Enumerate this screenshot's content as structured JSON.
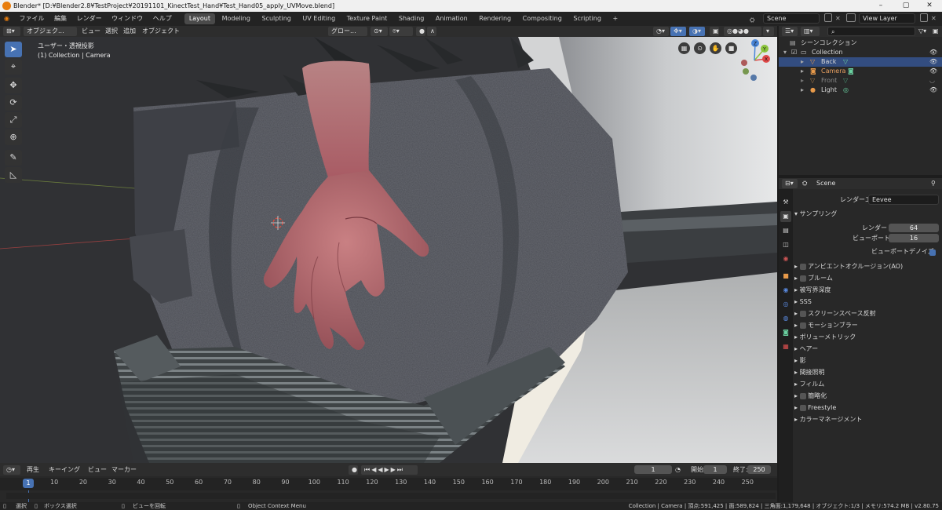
{
  "title_bar": {
    "title": "Blender* [D:¥Blender2.8¥TestProject¥20191101_KinectTest_Hand¥Test_Hand05_apply_UVMove.blend]",
    "minimize": "–",
    "maximize": "▢",
    "close": "✕"
  },
  "menu": [
    "ファイル",
    "編集",
    "レンダー",
    "ウィンドウ",
    "ヘルプ"
  ],
  "workspaces": [
    "Layout",
    "Modeling",
    "Sculpting",
    "UV Editing",
    "Texture Paint",
    "Shading",
    "Animation",
    "Rendering",
    "Compositing",
    "Scripting"
  ],
  "workspace_add": "+",
  "scene_name": "Scene",
  "view_layer": "View Layer",
  "viewport_header": {
    "mode": "オブジェク...",
    "menus": [
      "ビュー",
      "選択",
      "追加",
      "オブジェクト"
    ],
    "transform_orientation": "グロー..."
  },
  "viewport": {
    "view_name": "ユーザー・透視投影",
    "collection_info": "(1) Collection | Camera"
  },
  "gizmo_axes": {
    "x": "X",
    "y": "Y",
    "z": "Z"
  },
  "outliner": {
    "root": "シーンコレクション",
    "collection": "Collection",
    "items": [
      {
        "name": "Back",
        "selected": true
      },
      {
        "name": "Camera",
        "selected": false
      },
      {
        "name": "Front",
        "selected": false
      },
      {
        "name": "Light",
        "selected": false
      }
    ]
  },
  "properties": {
    "context": "Scene",
    "render_engine_label": "レンダーエンジン",
    "render_engine": "Eevee",
    "sampling_panel": "サンプリング",
    "render_samples_label": "レンダー",
    "render_samples": "64",
    "viewport_samples_label": "ビューポート",
    "viewport_samples": "16",
    "viewport_denoise_label": "ビューポートデノイズ",
    "panels": [
      {
        "label": "アンビエントオクルージョン(AO)",
        "checkbox": true
      },
      {
        "label": "ブルーム",
        "checkbox": true
      },
      {
        "label": "被写界深度",
        "checkbox": false
      },
      {
        "label": "SSS",
        "checkbox": false
      },
      {
        "label": "スクリーンスペース反射",
        "checkbox": true
      },
      {
        "label": "モーションブラー",
        "checkbox": true
      },
      {
        "label": "ボリューメトリック",
        "checkbox": false
      },
      {
        "label": "ヘアー",
        "checkbox": false
      },
      {
        "label": "影",
        "checkbox": false
      },
      {
        "label": "間接照明",
        "checkbox": false
      },
      {
        "label": "フィルム",
        "checkbox": false
      },
      {
        "label": "簡略化",
        "checkbox": true
      },
      {
        "label": "Freestyle",
        "checkbox": true
      },
      {
        "label": "カラーマネージメント",
        "checkbox": false
      }
    ]
  },
  "timeline": {
    "menus": [
      "再生",
      "キーイング",
      "ビュー",
      "マーカー"
    ],
    "current_frame": "1",
    "start_label": "開始:",
    "start": "1",
    "end_label": "終了:",
    "end": "250",
    "ruler_ticks": [
      "10",
      "20",
      "30",
      "40",
      "50",
      "60",
      "70",
      "80",
      "90",
      "100",
      "110",
      "120",
      "130",
      "140",
      "150",
      "160",
      "170",
      "180",
      "190",
      "200",
      "210",
      "220",
      "230",
      "240",
      "250"
    ]
  },
  "status_bar": {
    "select": "選択",
    "box_select": "ボックス選択",
    "rotate_view": "ビューを回転",
    "context_menu": "Object Context Menu",
    "stats": "Collection | Camera | 頂点:591,425 | 面:589,824 | 三角面:1,179,648 | オブジェクト:1/3 | メモリ:574.2 MB | v2.80.75"
  },
  "colors": {
    "accent_blue": "#4772b3",
    "selection_row": "#334d80",
    "background": "#2f3033",
    "panel": "#282828",
    "logo_orange": "#e87d0d"
  },
  "icons": {
    "cursor": "⌖",
    "move": "✥",
    "rotate": "⟳",
    "scale": "⤢",
    "transform": "⊕",
    "annotate": "✎",
    "measure": "📐",
    "zoom": "⊙",
    "hand": "✋",
    "camera": "🎥",
    "play": "▶",
    "pin": "📌",
    "eye": "👁"
  }
}
